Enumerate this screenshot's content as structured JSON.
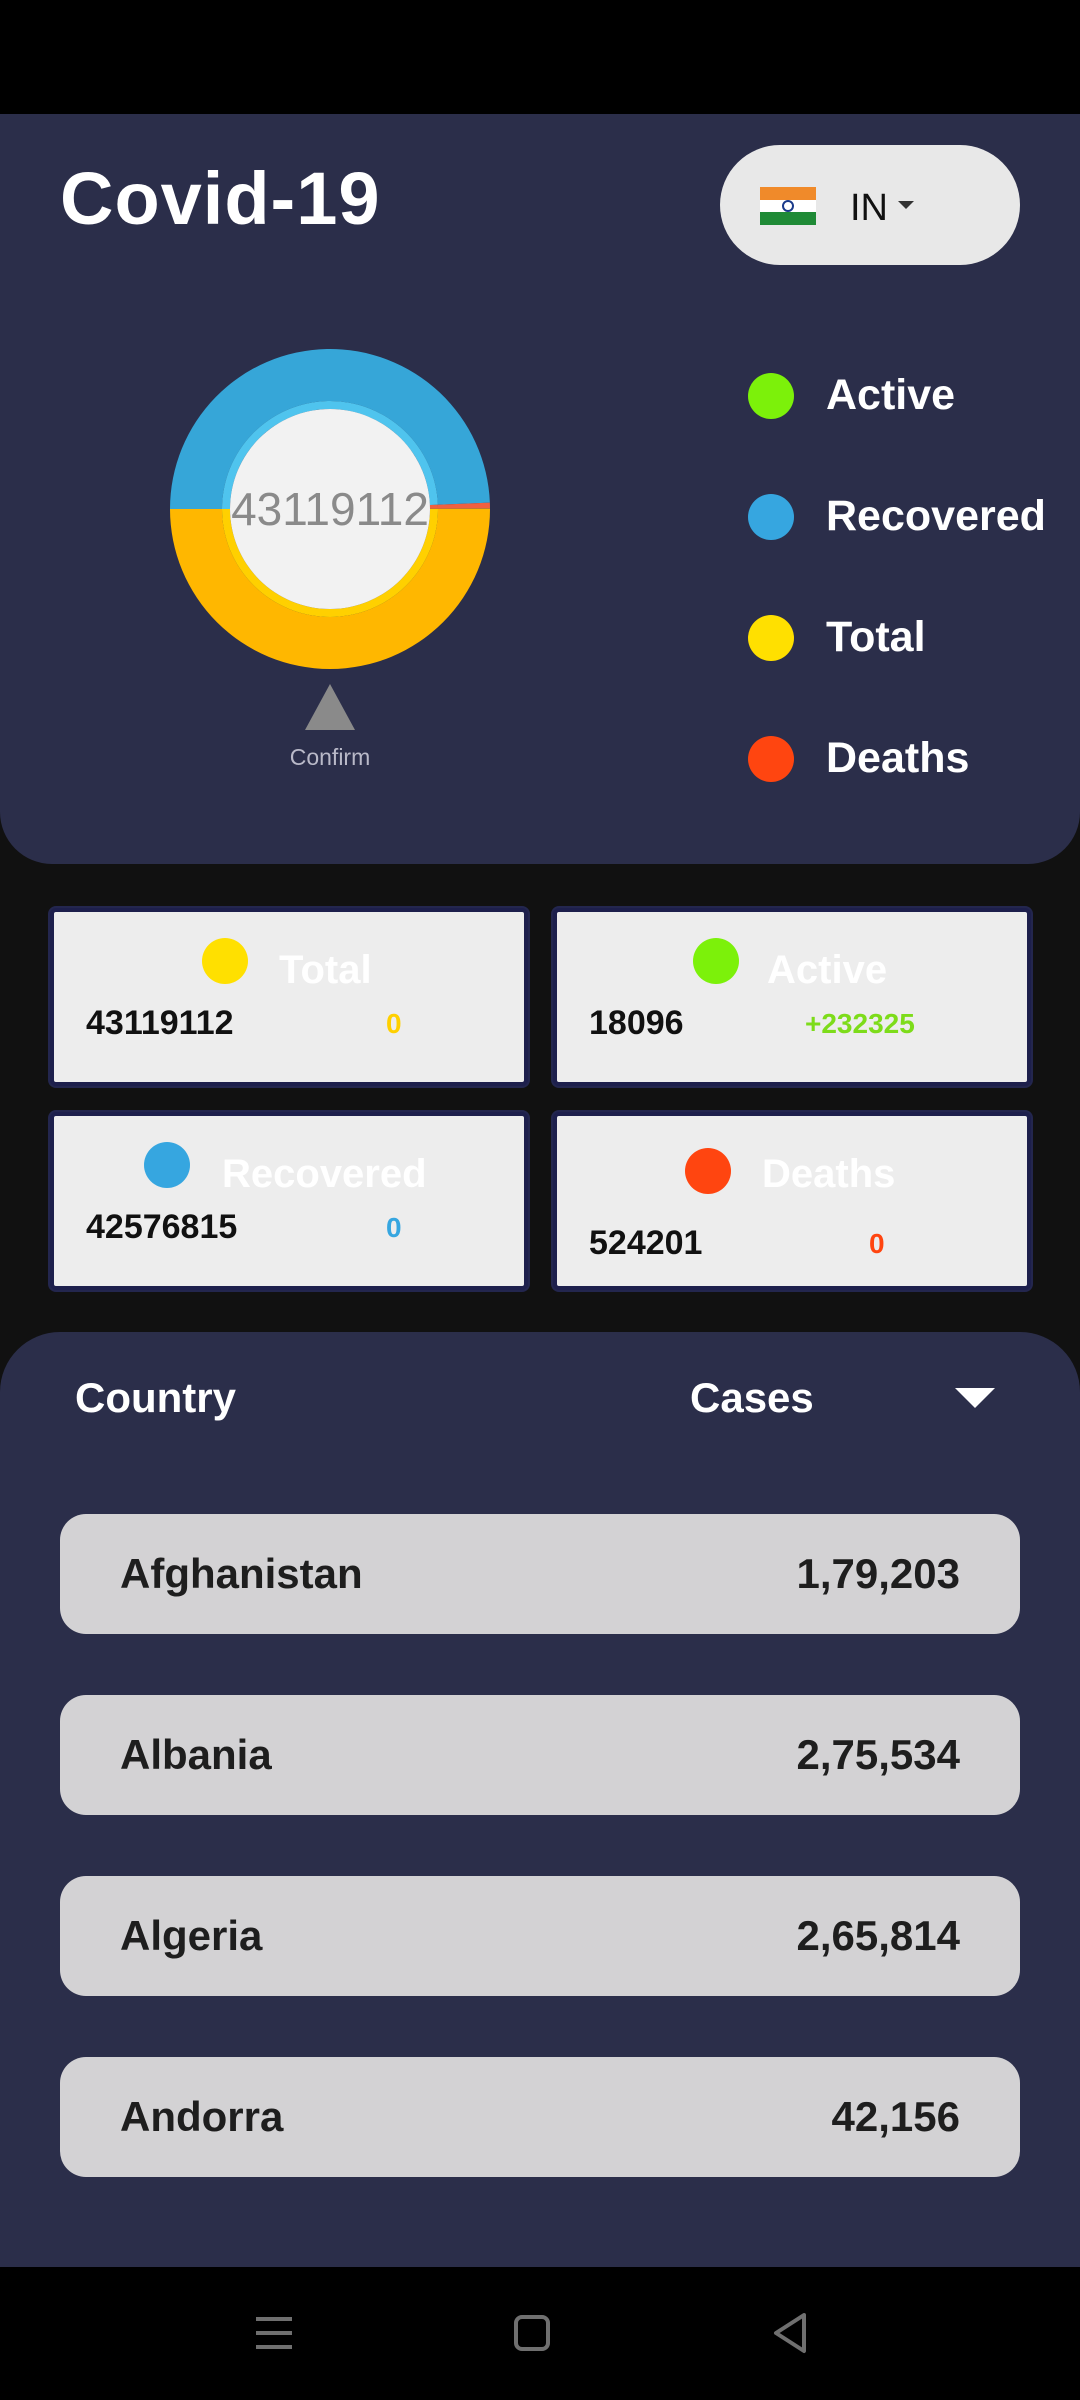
{
  "header": {
    "title": "Covid-19"
  },
  "country_selector": {
    "code": "IN",
    "flag": "india-flag"
  },
  "chart_data": {
    "type": "pie",
    "center_value": "43119112",
    "marker_label": "Confirm",
    "slices": [
      {
        "name": "Active",
        "value": 18096,
        "color": "#78f00f"
      },
      {
        "name": "Recovered",
        "value": 42576815,
        "color": "#36a6d8"
      },
      {
        "name": "Deaths",
        "value": 524201,
        "color": "#f06040"
      },
      {
        "name": "Total",
        "value": 43119112,
        "color": "#ffb700"
      }
    ]
  },
  "legend": [
    {
      "label": "Active",
      "color": "#7cf10a"
    },
    {
      "label": "Recovered",
      "color": "#36a6e0"
    },
    {
      "label": "Total",
      "color": "#ffe000"
    },
    {
      "label": "Deaths",
      "color": "#ff4510"
    }
  ],
  "cards": {
    "total": {
      "title": "Total",
      "value": "43119112",
      "delta": "0",
      "dot_color": "#ffe000",
      "delta_color": "#ffd000"
    },
    "active": {
      "title": "Active",
      "value": "18096",
      "delta": "+232325",
      "dot_color": "#7cf10a",
      "delta_color": "#7ddc1a"
    },
    "recovered": {
      "title": "Recovered",
      "value": "42576815",
      "delta": "0",
      "dot_color": "#36a6e0",
      "delta_color": "#36a6e0"
    },
    "deaths": {
      "title": "Deaths",
      "value": "524201",
      "delta": "0",
      "dot_color": "#ff4510",
      "delta_color": "#ff4510"
    }
  },
  "list": {
    "header_country": "Country",
    "header_cases": "Cases",
    "rows": [
      {
        "country": "Afghanistan",
        "cases": "1,79,203"
      },
      {
        "country": "Albania",
        "cases": "2,75,534"
      },
      {
        "country": "Algeria",
        "cases": "2,65,814"
      },
      {
        "country": "Andorra",
        "cases": "42,156"
      }
    ]
  },
  "nav": {
    "menu_icon": "menu-icon",
    "home_icon": "home-icon",
    "back_icon": "back-icon"
  }
}
